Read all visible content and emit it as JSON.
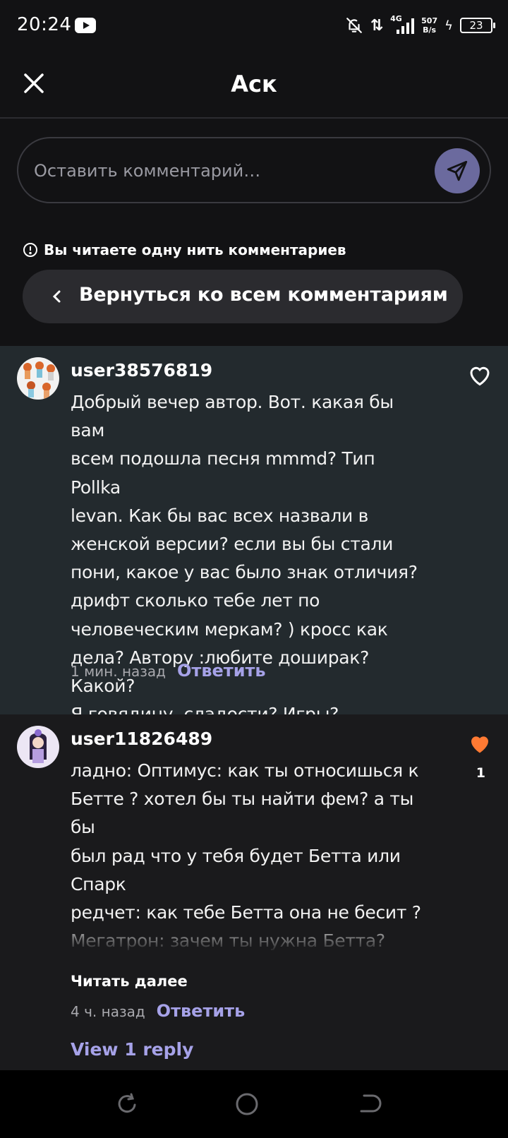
{
  "status_bar": {
    "time": "20:24",
    "network": "4G",
    "speed_top": "507",
    "speed_bottom": "B/s",
    "battery": "23",
    "icons": [
      "youtube-icon",
      "bell-off-icon",
      "data-arrows-icon",
      "signal-icon",
      "charging-icon",
      "battery-icon"
    ]
  },
  "header": {
    "title": "Аск"
  },
  "comment_input": {
    "placeholder": "Оставить комментарий…"
  },
  "thread": {
    "info_text": "Вы читаете одну нить комментариев",
    "back_label": "Вернуться ко всем комментариям"
  },
  "comments": [
    {
      "username": "user38576819",
      "text": "Добрый вечер автор. Вот. какая бы вам\nвсем подошла песня mmmd? Тип Pollka\nlevan. Как бы вас всех назвали в\nженской версии? если вы бы стали\nпони, какое у вас было знак отличия?\nдрифт сколько тебе лет по\nчеловеческим меркам? ) кросс как\nдела? Автору :любите доширак? Какой?\nЯ говядину. сладости? Игры? Хорошего\nвам вечера.",
      "time": "1 мин. назад",
      "reply_label": "Ответить",
      "liked": false
    },
    {
      "username": "user11826489",
      "text": "ладно: Оптимус: как ты относишься к\nБетте ? хотел бы ты найти фем? а ты бы\nбыл рад что у тебя будет Бетта или\nСпарк\nредчет: как тебе Бетта она не бесит ?\nМегатрон: зачем ты нужна Бетта?\nдесептиконам и автоботам : может",
      "read_more": "Читать далее",
      "time": "4 ч. назад",
      "reply_label": "Ответить",
      "liked": true,
      "like_count": "1",
      "view_replies": "View 1 reply"
    }
  ],
  "colors": {
    "background": "#121214",
    "accent": "#a6a2e8",
    "send_button": "#6b6a9e",
    "like_active": "#ff7a33",
    "highlight_comment": "#232a2e"
  }
}
